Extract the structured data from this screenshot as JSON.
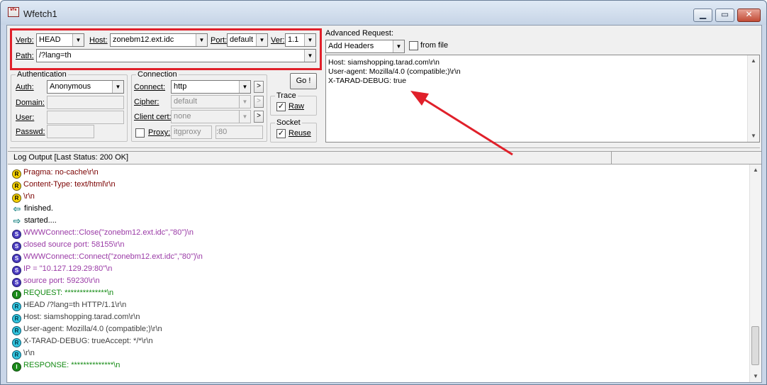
{
  "window": {
    "title": "Wfetch1",
    "app_icon_text": "Wfe"
  },
  "request": {
    "verb_label": "Verb:",
    "verb_value": "HEAD",
    "host_label": "Host:",
    "host_value": "zonebm12.ext.idc",
    "port_label": "Port:",
    "port_value": "default",
    "ver_label": "Ver:",
    "ver_value": "1.1",
    "path_label": "Path:",
    "path_value": "/?lang=th"
  },
  "authentication": {
    "group_title": "Authentication",
    "auth_label": "Auth:",
    "auth_value": "Anonymous",
    "domain_label": "Domain:",
    "user_label": "User:",
    "passwd_label": "Passwd:"
  },
  "connection": {
    "group_title": "Connection",
    "connect_label": "Connect:",
    "connect_value": "http",
    "cipher_label": "Cipher:",
    "cipher_value": "default",
    "client_cert_label": "Client cert:",
    "client_cert_value": "none",
    "proxy_label": "Proxy:",
    "proxy_host": "itgproxy",
    "proxy_port": ":80",
    "more_glyph": ">"
  },
  "go_button": "Go !",
  "trace": {
    "group_title": "Trace",
    "raw_label": "Raw",
    "raw_checked": true
  },
  "socket": {
    "group_title": "Socket",
    "reuse_label": "Reuse",
    "reuse_checked": true
  },
  "advanced": {
    "label": "Advanced Request:",
    "select_value": "Add Headers",
    "from_file_label": "from file",
    "lines": [
      "Host: siamshopping.tarad.com\\r\\n",
      "User-agent: Mozilla/4.0 (compatible;)\\r\\n",
      "X-TARAD-DEBUG: true"
    ]
  },
  "log": {
    "header": "Log Output [Last Status: 200 OK]",
    "rows": [
      {
        "icon": "r-y",
        "glyph": "R",
        "color": "c-red",
        "text": "Pragma: no-cache\\r\\n"
      },
      {
        "icon": "r-y",
        "glyph": "R",
        "color": "c-red",
        "text": "Content-Type: text/html\\r\\n"
      },
      {
        "icon": "r-y",
        "glyph": "R",
        "color": "c-red",
        "text": "\\r\\n"
      },
      {
        "icon": "arr-l",
        "glyph": "⇦",
        "color": "c-black",
        "text": "finished."
      },
      {
        "icon": "arr-r",
        "glyph": "⇨",
        "color": "c-black",
        "text": "started...."
      },
      {
        "icon": "s",
        "glyph": "S",
        "color": "c-purple",
        "text": "WWWConnect::Close(\"zonebm12.ext.idc\",\"80\")\\n"
      },
      {
        "icon": "s",
        "glyph": "S",
        "color": "c-purple",
        "text": "closed source port: 58155\\r\\n"
      },
      {
        "icon": "s",
        "glyph": "S",
        "color": "c-purple",
        "text": "WWWConnect::Connect(\"zonebm12.ext.idc\",\"80\")\\n"
      },
      {
        "icon": "s",
        "glyph": "S",
        "color": "c-purple",
        "text": "IP = \"10.127.129.29:80\"\\n"
      },
      {
        "icon": "s",
        "glyph": "S",
        "color": "c-purple",
        "text": "source port: 59230\\r\\n"
      },
      {
        "icon": "i",
        "glyph": "I",
        "color": "c-green",
        "text": "REQUEST: **************\\n"
      },
      {
        "icon": "r-c",
        "glyph": "R",
        "color": "c-gray",
        "text": "HEAD /?lang=th HTTP/1.1\\r\\n"
      },
      {
        "icon": "r-c",
        "glyph": "R",
        "color": "c-gray",
        "text": "Host: siamshopping.tarad.com\\r\\n"
      },
      {
        "icon": "r-c",
        "glyph": "R",
        "color": "c-gray",
        "text": "User-agent: Mozilla/4.0 (compatible;)\\r\\n"
      },
      {
        "icon": "r-c",
        "glyph": "R",
        "color": "c-gray",
        "text": "X-TARAD-DEBUG: trueAccept: */*\\r\\n"
      },
      {
        "icon": "r-c",
        "glyph": "R",
        "color": "c-gray",
        "text": "\\r\\n"
      },
      {
        "icon": "i",
        "glyph": "I",
        "color": "c-green",
        "text": "RESPONSE: **************\\n"
      }
    ]
  },
  "colors": {
    "highlight": "#e0202a",
    "arrow": "#e0202a",
    "accent": "#138a13"
  }
}
